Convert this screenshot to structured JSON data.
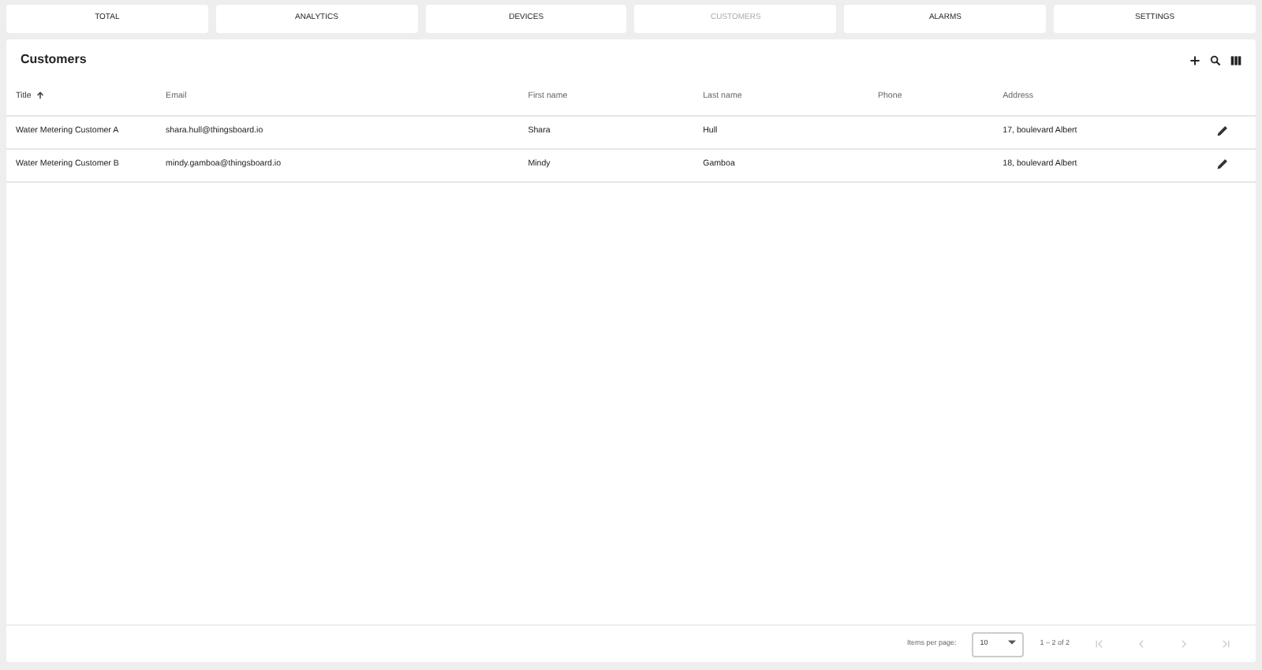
{
  "tabs": [
    {
      "label": "TOTAL",
      "selected": false
    },
    {
      "label": "ANALYTICS",
      "selected": false
    },
    {
      "label": "DEVICES",
      "selected": false
    },
    {
      "label": "CUSTOMERS",
      "selected": true
    },
    {
      "label": "ALARMS",
      "selected": false
    },
    {
      "label": "SETTINGS",
      "selected": false
    }
  ],
  "table": {
    "title": "Customers",
    "columns": [
      {
        "label": "Title",
        "sorted": true
      },
      {
        "label": "Email",
        "sorted": false
      },
      {
        "label": "First name",
        "sorted": false
      },
      {
        "label": "Last name",
        "sorted": false
      },
      {
        "label": "Phone",
        "sorted": false
      },
      {
        "label": "Address",
        "sorted": false
      }
    ],
    "rows": [
      [
        "Water Metering Customer A",
        "shara.hull@thingsboard.io",
        "Shara",
        "Hull",
        "",
        "17, boulevard Albert"
      ],
      [
        "Water Metering Customer B",
        "mindy.gamboa@thingsboard.io",
        "Mindy",
        "Gamboa",
        "",
        "18, boulevard Albert"
      ]
    ]
  },
  "paginator": {
    "label": "Items per page:",
    "page_size": "10",
    "range": "1 – 2 of 2",
    "buttons": [
      {
        "kind": "first",
        "disabled": true
      },
      {
        "kind": "prev",
        "disabled": true
      },
      {
        "kind": "next",
        "disabled": true
      },
      {
        "kind": "last",
        "disabled": true
      }
    ]
  }
}
